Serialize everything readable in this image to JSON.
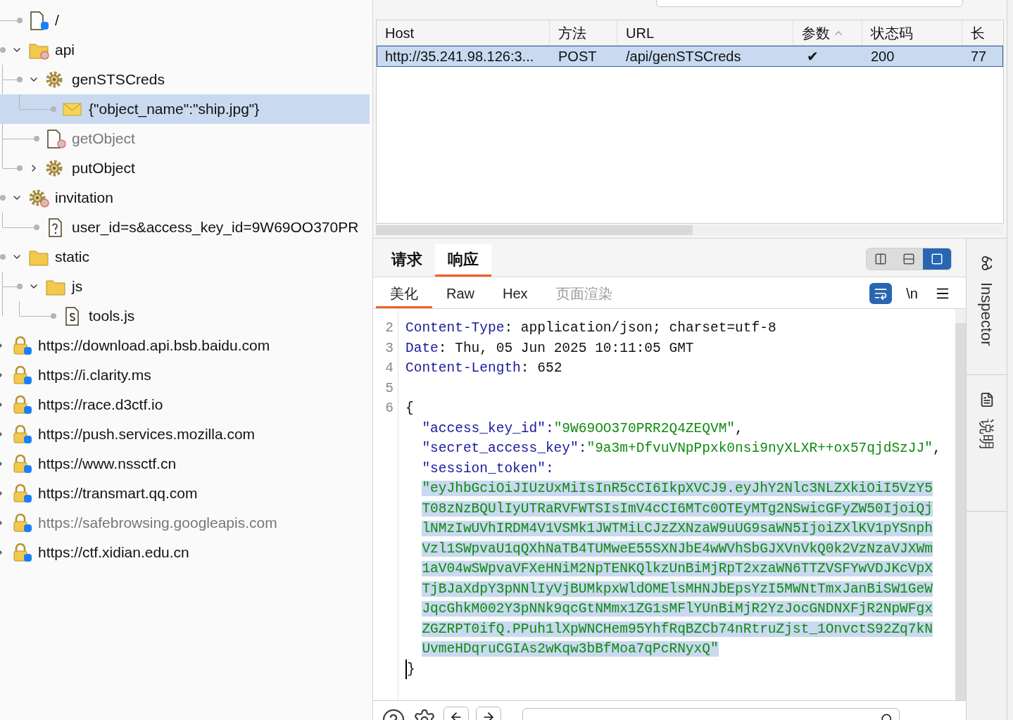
{
  "tree": {
    "branch": [
      {
        "label": "/",
        "kind": "root",
        "selected": false,
        "dimmed": false
      },
      {
        "label": "api",
        "kind": "flaggedfolder",
        "expanded": true,
        "selected": false,
        "dimmed": false,
        "children": [
          {
            "label": "genSTSCreds",
            "kind": "endpoint",
            "expanded": true,
            "selected": false,
            "dimmed": false,
            "children": [
              {
                "label": "{\"object_name\":\"ship.jpg\"}",
                "kind": "message",
                "selected": true,
                "dimmed": false
              }
            ]
          },
          {
            "label": "getObject",
            "kind": "flaggedpage",
            "selected": false,
            "dimmed": true
          },
          {
            "label": "putObject",
            "kind": "endpoint",
            "expanded": false,
            "selected": false,
            "dimmed": false
          }
        ]
      },
      {
        "label": "invitation",
        "kind": "flaggedendpoint",
        "expanded": true,
        "selected": false,
        "dimmed": false,
        "children": [
          {
            "label": "user_id=s&access_key_id=9W69OO370PR",
            "kind": "query",
            "selected": false,
            "dimmed": false
          }
        ]
      },
      {
        "label": "static",
        "kind": "folder",
        "expanded": true,
        "selected": false,
        "dimmed": false,
        "children": [
          {
            "label": "js",
            "kind": "folder",
            "expanded": true,
            "selected": false,
            "dimmed": false,
            "children": [
              {
                "label": "tools.js",
                "kind": "script",
                "selected": false,
                "dimmed": false
              }
            ]
          }
        ]
      }
    ],
    "hosts": [
      {
        "label": "https://download.api.bsb.baidu.com",
        "kind": "host",
        "expanded": false,
        "selected": false,
        "dimmed": false
      },
      {
        "label": "https://i.clarity.ms",
        "kind": "host",
        "expanded": false,
        "selected": false,
        "dimmed": false
      },
      {
        "label": "https://race.d3ctf.io",
        "kind": "host",
        "expanded": false,
        "selected": false,
        "dimmed": false
      },
      {
        "label": "https://push.services.mozilla.com",
        "kind": "host",
        "expanded": false,
        "selected": false,
        "dimmed": false
      },
      {
        "label": "https://www.nssctf.cn",
        "kind": "host",
        "expanded": false,
        "selected": false,
        "dimmed": false
      },
      {
        "label": "https://transmart.qq.com",
        "kind": "host",
        "expanded": false,
        "selected": false,
        "dimmed": false
      },
      {
        "label": "https://safebrowsing.googleapis.com",
        "kind": "host",
        "expanded": false,
        "selected": false,
        "dimmed": true
      },
      {
        "label": "https://ctf.xidian.edu.cn",
        "kind": "host",
        "expanded": false,
        "selected": false,
        "dimmed": false
      }
    ]
  },
  "table": {
    "columns": [
      {
        "label": "Host",
        "sorted": false
      },
      {
        "label": "方法",
        "sorted": false
      },
      {
        "label": "URL",
        "sorted": false
      },
      {
        "label": "参数",
        "sorted": true
      },
      {
        "label": "状态码",
        "sorted": false
      },
      {
        "label": "长",
        "sorted": false
      }
    ],
    "rows": [
      {
        "selected": true,
        "cells": [
          "http://35.241.98.126:3...",
          "POST",
          "/api/genSTSCreds",
          "✔",
          "200",
          "77"
        ]
      }
    ]
  },
  "message_tabs": [
    {
      "label": "请求",
      "selected": false
    },
    {
      "label": "响应",
      "selected": true
    }
  ],
  "layout_toggles": [
    {
      "kind": "columns",
      "selected": false
    },
    {
      "kind": "rows",
      "selected": false
    },
    {
      "kind": "single",
      "selected": true
    }
  ],
  "view_tabs": [
    {
      "label": "美化",
      "selected": true,
      "disabled": false
    },
    {
      "label": "Raw",
      "selected": false,
      "disabled": false
    },
    {
      "label": "Hex",
      "selected": false,
      "disabled": false
    },
    {
      "label": "页面渲染",
      "selected": false,
      "disabled": true
    }
  ],
  "editor_tools": {
    "wrap_on": true,
    "newline_label": "\\n"
  },
  "editor": {
    "headers": [
      {
        "number": "2",
        "name": "Content-Type",
        "value": ": application/json; charset=utf-8"
      },
      {
        "number": "3",
        "name": "Date",
        "value": ": Thu, 05 Jun 2025 10:11:05 GMT"
      },
      {
        "number": "4",
        "name": "Content-Length",
        "value": ": 652"
      }
    ],
    "blank_number": "5",
    "open": {
      "number": "6",
      "text": "{"
    },
    "entries": [
      {
        "key": "\"access_key_id\":",
        "value": "\"9W69OO370PRR2Q4ZEQVM\"",
        "trailing": ",",
        "highlighted": false
      },
      {
        "key": "\"secret_access_key\":",
        "value": "\"9a3m+DfvuVNpPpxk0nsi9nyXLXR++ox57qjdSzJJ\"",
        "trailing": ",",
        "highlighted": false
      },
      {
        "key": "\"session_token\":",
        "value": "\"eyJhbGciOiJIUzUxMiIsInR5cCI6IkpXVCJ9.eyJhY2Nlc3NLZXkiOiI5VzY5T08zNzBQUlIyUTRaRVFWTSIsImV4cCI6MTc0OTEyMTg2NSwicGFyZW50IjoiQjlNMzIwUVhIRDM4V1VSMk1JWTMiLCJzZXNzaW9uUG9saWN5IjoiZXlKV1pYSnphVzl1SWpvaU1qQXhNaTB4TUMweE55SXNJbE4wWVhSbGJXVnVkQ0k2VzNzaVJXWm1aV04wSWpvaVFXeHNiM2NpTENKQlkzUnBiMjRpT2xzaWN6TTZVSFYwVDJKcVpXTjBJaXdpY3pNNlIyVjBUMkpxWldOMElsMHNJbEpsYzI5MWNtTmxJanBiSW1GeWJqcGhkM002Y3pNNk9qcGtNMmx1ZG1sMFlYUnBiMjR2YzJocGNDNXFjR2NpWFgxZGZRPT0ifQ.PPuh1lXpWNCHem95YhfRqBZCb74nRtruZjst_1OnvctS92Zq7kNUvmeHDqruCGIAs2wKqw3bBfMoa7qPcRNyxQ\"",
        "highlighted": true
      }
    ],
    "close": "}"
  },
  "side_tabs": [
    {
      "label": "Inspector",
      "kind": "inspector"
    },
    {
      "label": "说明",
      "kind": "notes"
    }
  ]
}
